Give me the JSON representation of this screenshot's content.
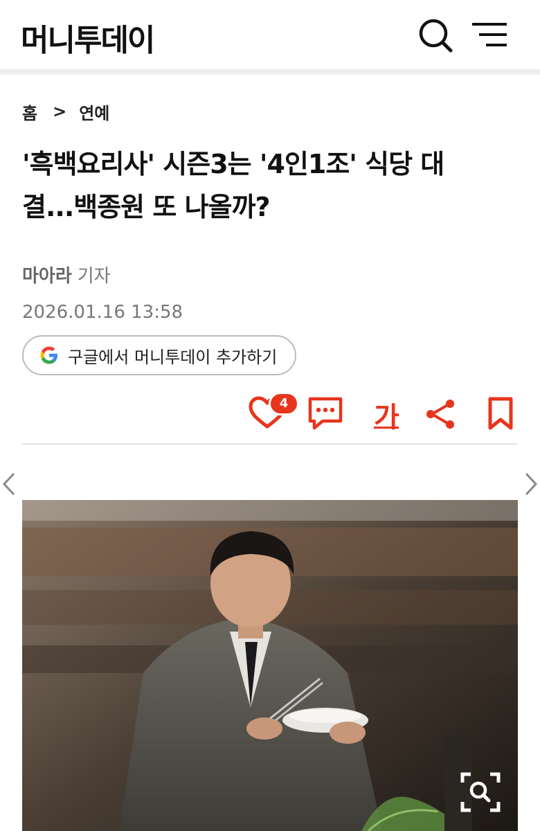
{
  "header": {
    "logo": "머니투데이",
    "search_icon": "search-icon",
    "menu_icon": "hamburger-menu-icon"
  },
  "breadcrumb": {
    "home": "홈",
    "separator": ">",
    "section": "연예"
  },
  "article": {
    "headline_line1": "'흑백요리사' 시즌3는 '4인1조' 식당 대",
    "headline_line2": "결...백종원 또 나올까?",
    "author": "마아라",
    "author_role": "기자",
    "datetime": "2026.01.16 13:58"
  },
  "google_button": {
    "label": "구글에서 머니투데이 추가하기",
    "icon": "google-icon"
  },
  "actions": {
    "like_count": "4",
    "font_label": "가",
    "icons": [
      "heart-icon",
      "comment-icon",
      "font-size-icon",
      "share-icon",
      "bookmark-icon"
    ]
  },
  "colors": {
    "accent": "#e8341c",
    "divider": "#eeeeee",
    "muted_text": "#777777"
  }
}
